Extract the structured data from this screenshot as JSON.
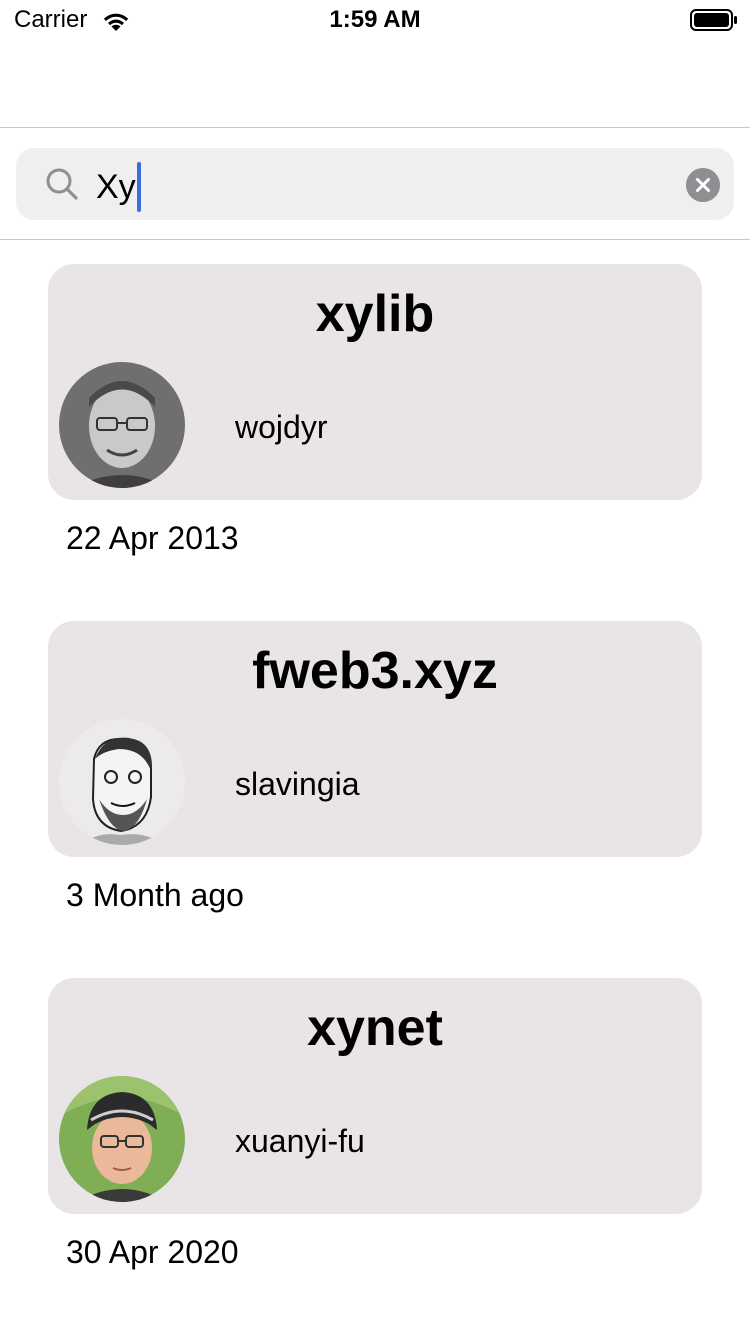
{
  "status_bar": {
    "carrier": "Carrier",
    "time": "1:59 AM",
    "icons": [
      "wifi-icon",
      "battery-icon"
    ]
  },
  "search": {
    "value": "Xy",
    "icons": [
      "search-icon",
      "clear-icon"
    ]
  },
  "results": [
    {
      "name": "xylib",
      "owner": "wojdyr",
      "date": "22 Apr 2013",
      "avatar": "avatar-wojdyr"
    },
    {
      "name": "fweb3.xyz",
      "owner": "slavingia",
      "date": "3 Month ago",
      "avatar": "avatar-slavingia"
    },
    {
      "name": "xynet",
      "owner": "xuanyi-fu",
      "date": "30 Apr 2020",
      "avatar": "avatar-xuanyi-fu"
    }
  ],
  "colors": {
    "card_background": "#e9e4e6",
    "search_background": "#efeff0",
    "caret": "#3a6de0",
    "separator": "#c8c8cc"
  }
}
